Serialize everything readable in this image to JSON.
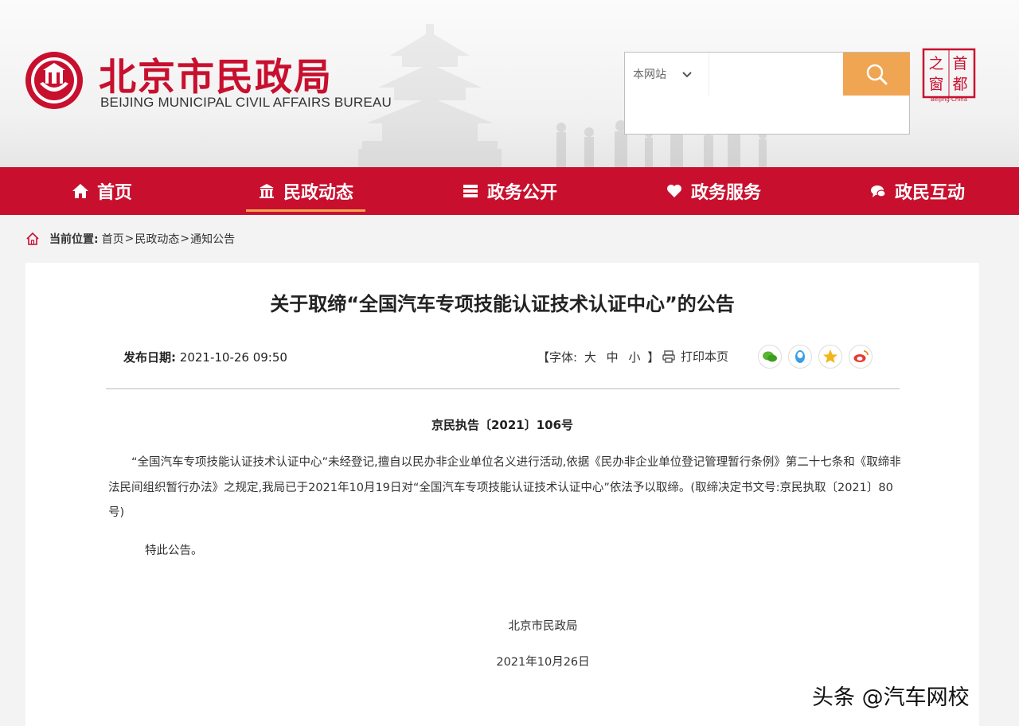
{
  "header": {
    "site_title": "北京市民政局",
    "site_subtitle": "BEIJING MUNICIPAL CIVIL AFFAIRS BUREAU",
    "search": {
      "scope": "本网站",
      "placeholder": ""
    },
    "capital_seal": {
      "chars": [
        "首",
        "都",
        "之",
        "窗"
      ],
      "caption": "Beijing·China"
    }
  },
  "nav": {
    "items": [
      {
        "label": "首页",
        "icon": "home-icon"
      },
      {
        "label": "民政动态",
        "icon": "building-icon",
        "active": true
      },
      {
        "label": "政务公开",
        "icon": "list-icon"
      },
      {
        "label": "政务服务",
        "icon": "heart-icon"
      },
      {
        "label": "政民互动",
        "icon": "chat-icon"
      }
    ]
  },
  "breadcrumb": {
    "label": "当前位置:",
    "items": [
      "首页",
      "民政动态",
      "通知公告"
    ],
    "separator": ">"
  },
  "article": {
    "title": "关于取缔“全国汽车专项技能认证技术认证中心”的公告",
    "date_label": "发布日期:",
    "date_value": "2021-10-26 09:50",
    "font_ctrl": {
      "open": "【字体:",
      "large": "大",
      "medium": "中",
      "small": "小",
      "close": "】"
    },
    "print_label": "打印本页",
    "share_icons": [
      "wechat-icon",
      "qq-icon",
      "qzone-icon",
      "weibo-icon"
    ],
    "doc_number": "京民执告〔2021〕106号",
    "body": "“全国汽车专项技能认证技术认证中心”未经登记,擅自以民办非企业单位名义进行活动,依据《民办非企业单位登记管理暂行条例》第二十七条和《取缔非法民间组织暂行办法》之规定,我局已于2021年10月19日对“全国汽车专项技能认证技术认证中心”依法予以取缔。(取缔决定书文号:京民执取〔2021〕80号)",
    "closing": "特此公告。",
    "signature": "北京市民政局",
    "sign_date": "2021年10月26日"
  },
  "watermark": "头条 @汽车网校",
  "colors": {
    "brand_red": "#c8102e",
    "search_orange": "#f0a553"
  }
}
